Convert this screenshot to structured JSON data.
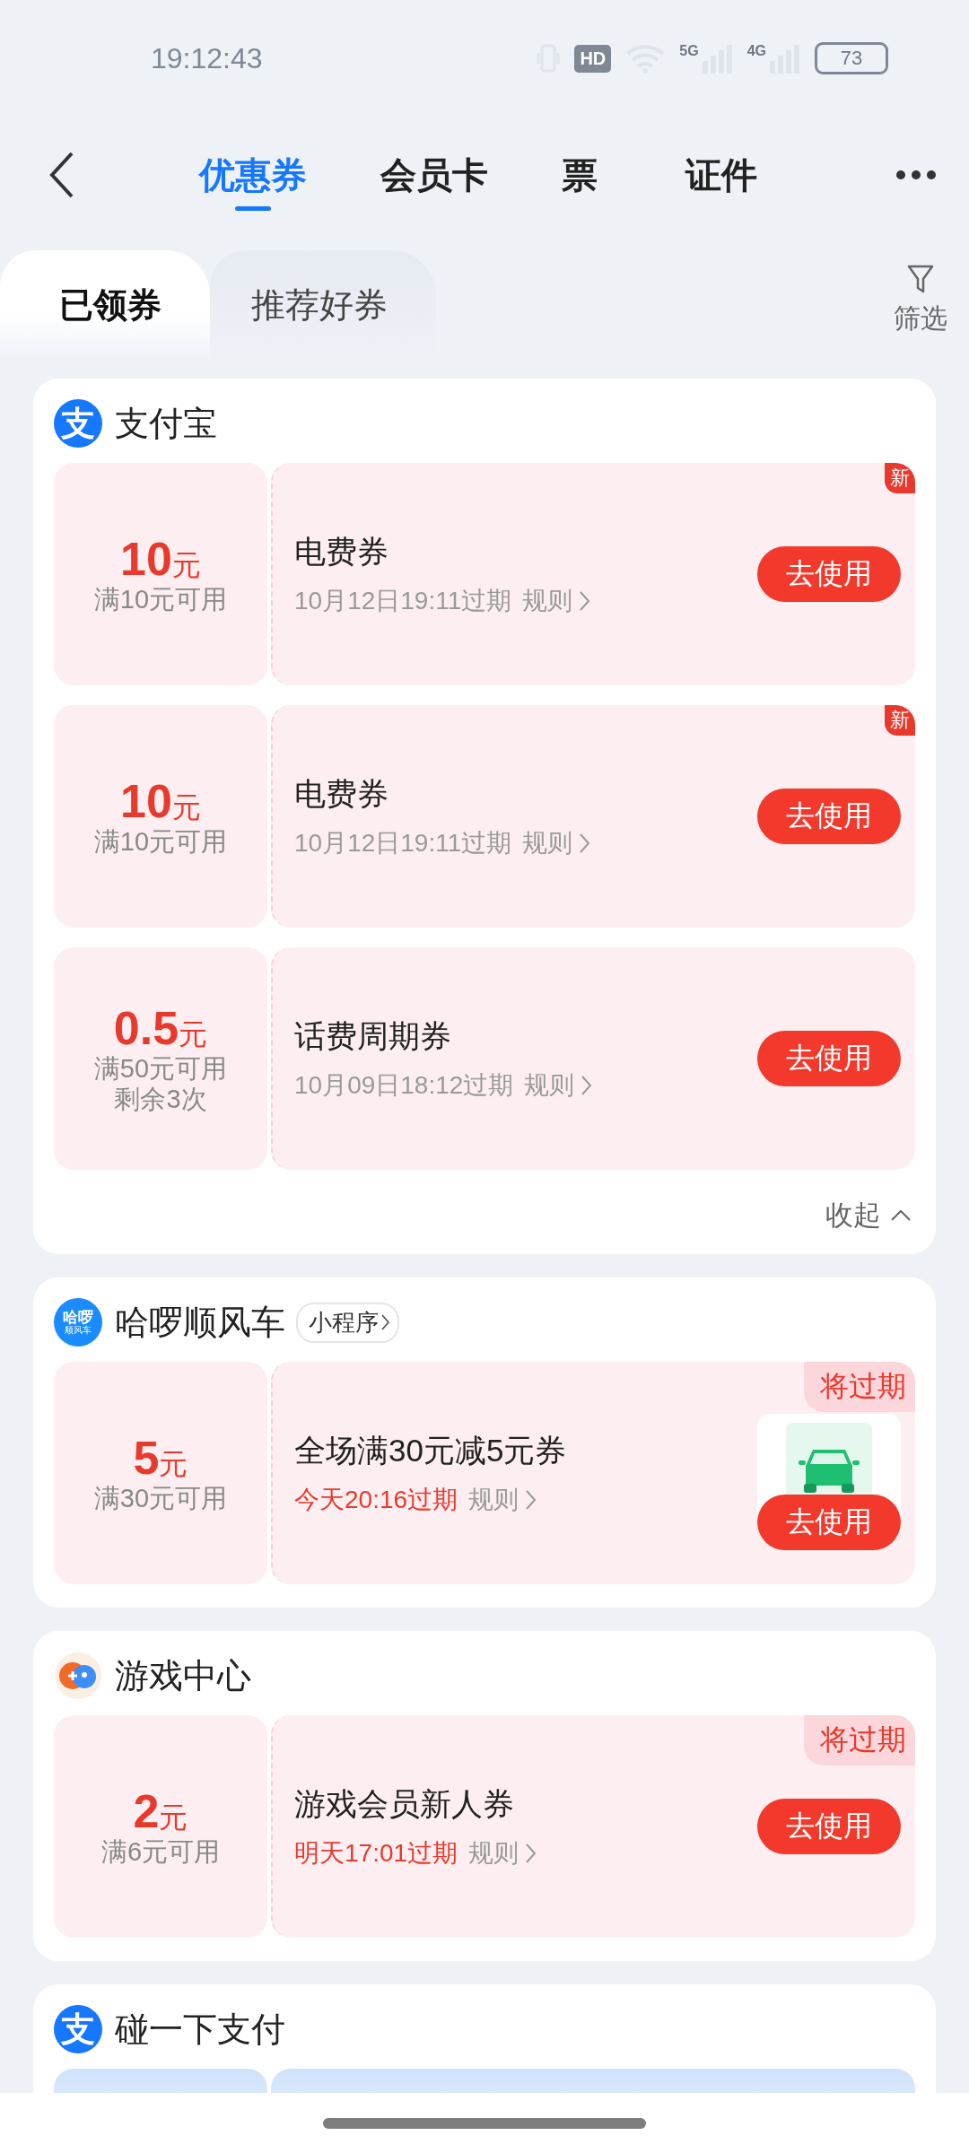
{
  "status_bar": {
    "time": "19:12:43",
    "hd": "HD",
    "signals": [
      "5G",
      "4G"
    ],
    "battery": "73"
  },
  "nav": {
    "tabs": [
      {
        "label": "优惠券",
        "selected": true
      },
      {
        "label": "会员卡",
        "selected": false
      },
      {
        "label": "票",
        "selected": false
      },
      {
        "label": "证件",
        "selected": false
      }
    ]
  },
  "sub_tabs": [
    {
      "label": "已领券",
      "selected": true
    },
    {
      "label": "推荐好券",
      "selected": false
    }
  ],
  "filter": {
    "label": "筛选"
  },
  "groups": [
    {
      "name": "支付宝",
      "logo": {
        "kind": "alipay",
        "text": [
          "支"
        ]
      },
      "coupons": [
        {
          "amount": "10",
          "unit": "元",
          "conditions": [
            "满10元可用"
          ],
          "title": "电费券",
          "expiry": "10月12日19:11过期",
          "expiring_soon": false,
          "rule": "规则",
          "button": "去使用",
          "badge": {
            "kind": "new",
            "text": "新"
          },
          "has_thumbnail": false
        },
        {
          "amount": "10",
          "unit": "元",
          "conditions": [
            "满10元可用"
          ],
          "title": "电费券",
          "expiry": "10月12日19:11过期",
          "expiring_soon": false,
          "rule": "规则",
          "button": "去使用",
          "badge": {
            "kind": "new",
            "text": "新"
          },
          "has_thumbnail": false
        },
        {
          "amount": "0.5",
          "unit": "元",
          "conditions": [
            "满50元可用",
            "剩余3次"
          ],
          "title": "话费周期券",
          "expiry": "10月09日18:12过期",
          "expiring_soon": false,
          "rule": "规则",
          "button": "去使用",
          "has_thumbnail": false
        }
      ],
      "collapse": "收起",
      "peek": false
    },
    {
      "name": "哈啰顺风车",
      "logo": {
        "kind": "haluo",
        "text": [
          "哈啰",
          "顺风车"
        ]
      },
      "tag": "小程序",
      "coupons": [
        {
          "amount": "5",
          "unit": "元",
          "conditions": [
            "满30元可用"
          ],
          "title": "全场满30元减5元券",
          "expiry": "今天20:16过期",
          "expiring_soon": true,
          "rule": "规则",
          "button": "去使用",
          "badge": {
            "kind": "expiring",
            "text": "将过期"
          },
          "has_thumbnail": true
        }
      ],
      "peek": false
    },
    {
      "name": "游戏中心",
      "logo": {
        "kind": "game"
      },
      "coupons": [
        {
          "amount": "2",
          "unit": "元",
          "conditions": [
            "满6元可用"
          ],
          "title": "游戏会员新人券",
          "expiry": "明天17:01过期",
          "expiring_soon": true,
          "rule": "规则",
          "button": "去使用",
          "badge": {
            "kind": "expiring",
            "text": "将过期"
          },
          "has_thumbnail": false
        }
      ],
      "peek": false
    },
    {
      "name": "碰一下支付",
      "logo": {
        "kind": "alipay",
        "text": [
          "支"
        ]
      },
      "peek": true
    }
  ]
}
